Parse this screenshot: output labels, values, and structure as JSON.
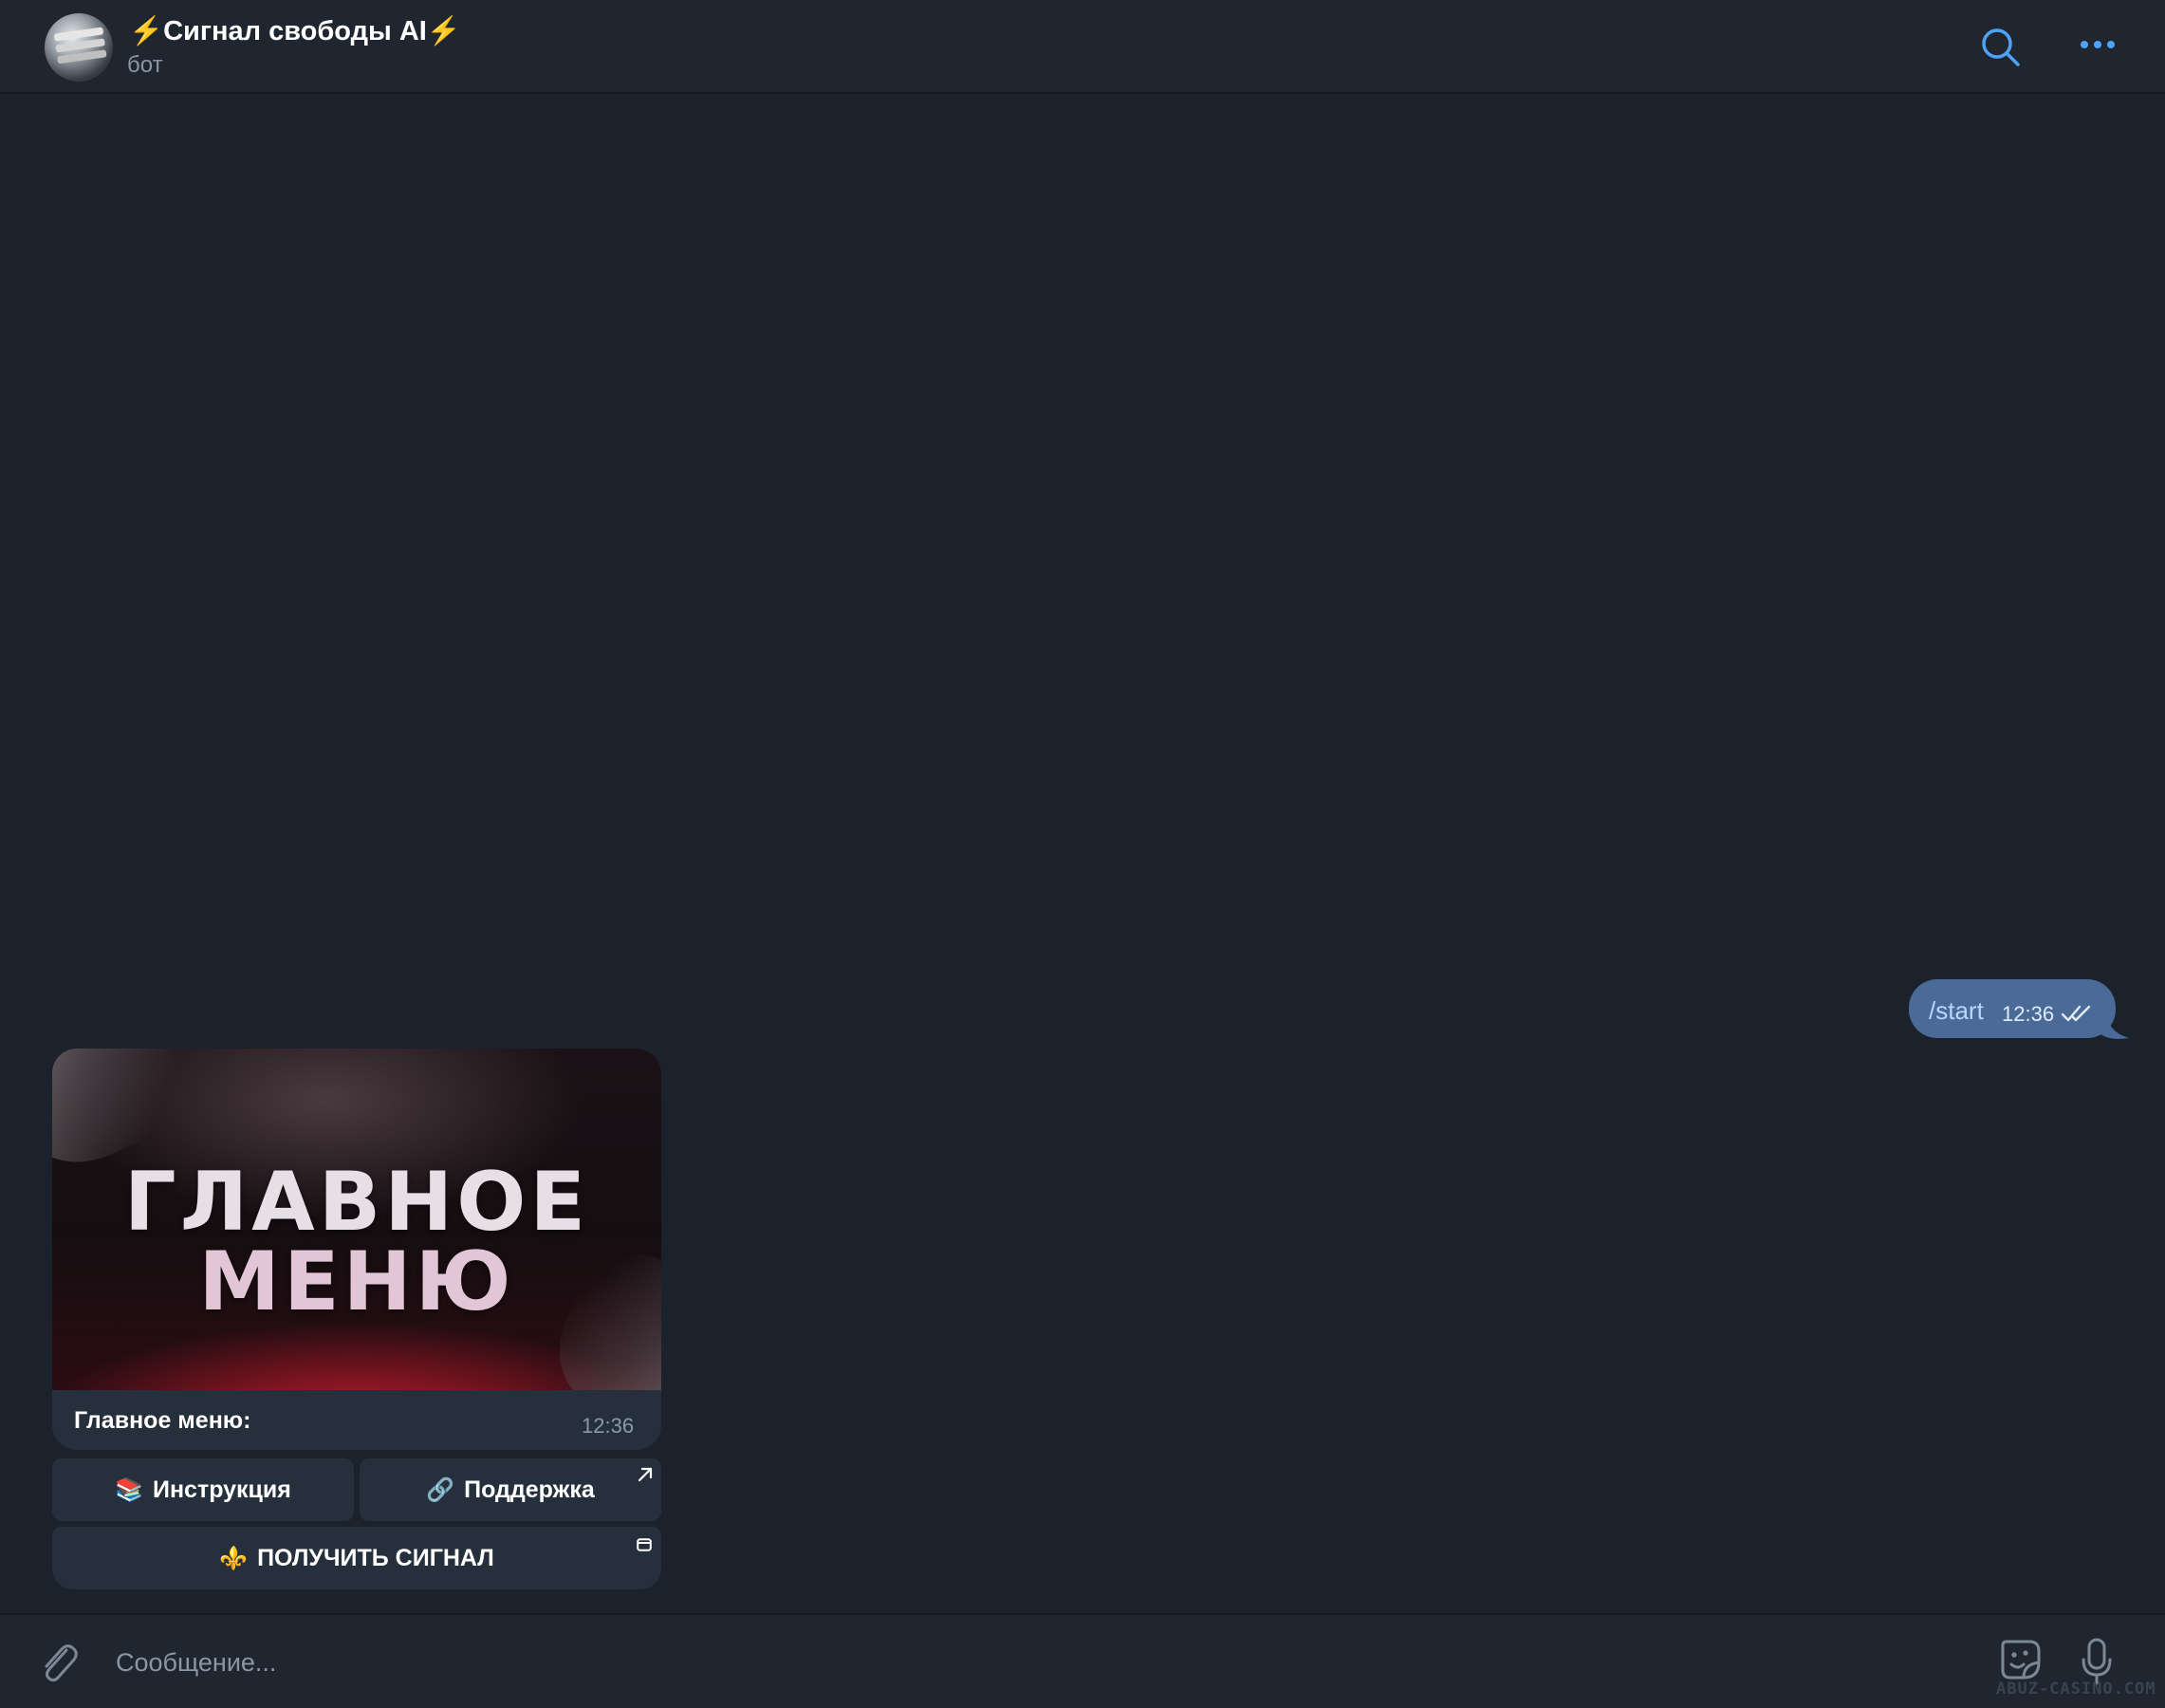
{
  "header": {
    "title": "⚡️Сигнал свободы AI⚡️",
    "subtitle": "бот",
    "icons": [
      "search-icon",
      "more-icon"
    ]
  },
  "messages": {
    "outgoing": {
      "text": "/start",
      "time": "12:36",
      "status": "read"
    },
    "incoming": {
      "banner_line1": "ГЛАВНОЕ",
      "banner_line2": "МЕНЮ",
      "caption": "Главное меню:",
      "time": "12:36"
    }
  },
  "keyboard": {
    "instruction_emoji": "📚",
    "instruction_label": "Инструкция",
    "support_emoji": "🔗",
    "support_label": "Поддержка",
    "signal_emoji": "⚜️",
    "signal_label": "ПОЛУЧИТЬ СИГНАЛ"
  },
  "composer": {
    "placeholder": "Сообщение..."
  },
  "watermark": "ABUZ-CASINO.COM",
  "colors": {
    "background": "#1b222c",
    "bar": "#1f2630",
    "outgoing_bubble": "#4a6a97",
    "accent": "#4fa3f7",
    "button": "#26303d"
  }
}
